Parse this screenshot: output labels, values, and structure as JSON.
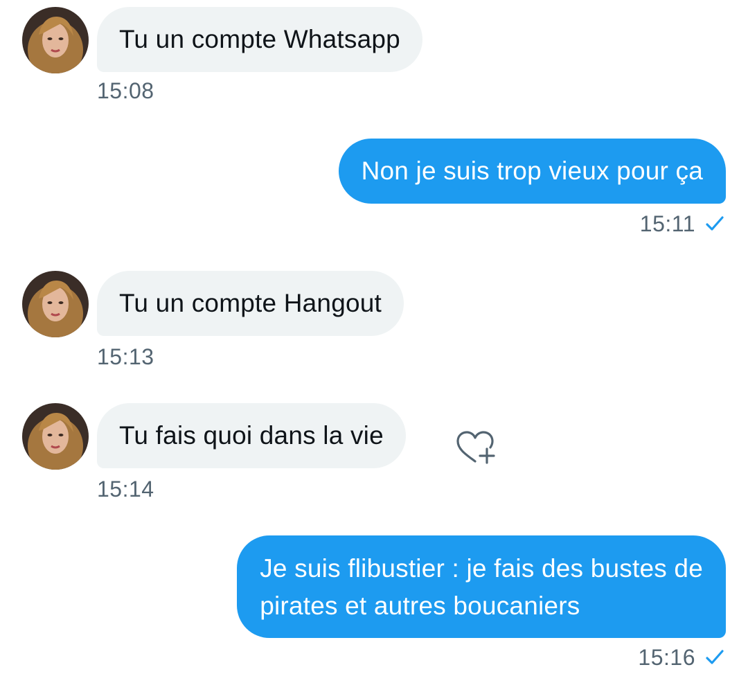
{
  "conversation": {
    "messages": [
      {
        "direction": "received",
        "text": "Tu un compte Whatsapp",
        "time": "15:08"
      },
      {
        "direction": "sent",
        "text": "Non je suis trop vieux pour ça",
        "time": "15:11",
        "status": "sent-check-icon"
      },
      {
        "direction": "received",
        "text": "Tu un compte Hangout",
        "time": "15:13"
      },
      {
        "direction": "received",
        "text": "Tu fais quoi dans la vie",
        "time": "15:14",
        "reaction_icon": "heart-plus-icon"
      },
      {
        "direction": "sent",
        "lines": [
          "Je suis flibustier : je fais des bustes de",
          "pirates et autres boucaniers"
        ],
        "time": "15:16",
        "status": "sent-check-icon"
      }
    ]
  },
  "colors": {
    "sent_bubble": "#1d9bf0",
    "received_bubble": "#eff3f4",
    "timestamp": "#536471",
    "text_dark": "#0f1419"
  }
}
